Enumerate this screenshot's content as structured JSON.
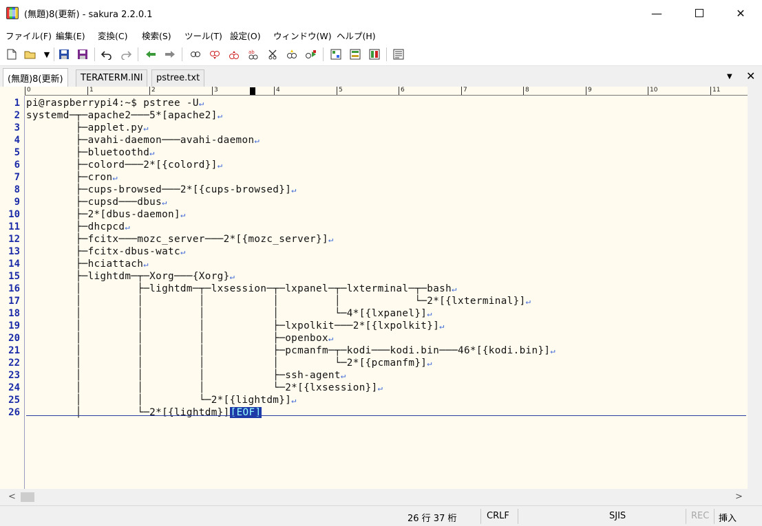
{
  "window": {
    "title": "(無題)8(更新) - sakura 2.2.0.1",
    "min_glyph": "—",
    "close_glyph": "✕"
  },
  "menu": [
    "ファイル(F)",
    "編集(E)",
    "変換(C)",
    "検索(S)",
    "ツール(T)",
    "設定(O)",
    "ウィンドウ(W)",
    "ヘルプ(H)"
  ],
  "toolbar_icons": [
    "new-file-icon",
    "open-file-icon",
    "open-dropdown-icon",
    "save-icon",
    "save-all-icon",
    "undo-icon",
    "redo-icon",
    "jump-back-icon",
    "jump-forward-icon",
    "search-icon",
    "search-next-icon",
    "search-prev-icon",
    "replace-icon",
    "grep-icon",
    "bookmark-icon",
    "mark-icon",
    "view-icon",
    "compare-icon",
    "outline-icon",
    "settings-icon"
  ],
  "tabs": [
    {
      "label": "(無題)8(更新)",
      "active": true
    },
    {
      "label": "TERATERM.INI",
      "active": false
    },
    {
      "label": "pstree.txt",
      "active": false
    }
  ],
  "tab_controls": {
    "dropdown": "▼",
    "close": "✕"
  },
  "ruler": {
    "labels": [
      "0",
      "1",
      "2",
      "3",
      "4",
      "5",
      "6",
      "7",
      "8",
      "9",
      "10",
      "11"
    ]
  },
  "editor": {
    "lines": [
      "pi@raspberrypi4:~$ pstree -U",
      "systemd─┬─apache2───5*[apache2]",
      "        ├─applet.py",
      "        ├─avahi-daemon───avahi-daemon",
      "        ├─bluetoothd",
      "        ├─colord───2*[{colord}]",
      "        ├─cron",
      "        ├─cups-browsed───2*[{cups-browsed}]",
      "        ├─cupsd───dbus",
      "        ├─2*[dbus-daemon]",
      "        ├─dhcpcd",
      "        ├─fcitx───mozc_server───2*[{mozc_server}]",
      "        ├─fcitx-dbus-watc",
      "        ├─hciattach",
      "        ├─lightdm─┬─Xorg───{Xorg}",
      "        │         ├─lightdm─┬─lxsession─┬─lxpanel─┬─lxterminal─┬─bash",
      "        │         │         │           │         │            └─2*[{lxterminal}]",
      "        │         │         │           │         └─4*[{lxpanel}]",
      "        │         │         │           ├─lxpolkit───2*[{lxpolkit}]",
      "        │         │         │           ├─openbox",
      "        │         │         │           ├─pcmanfm─┬─kodi───kodi.bin───46*[{kodi.bin}]",
      "        │         │         │           │         └─2*[{pcmanfm}]",
      "        │         │         │           ├─ssh-agent",
      "        │         │         │           └─2*[{lxsession}]",
      "        │         │         └─2*[{lightdm}]",
      "        │         └─2*[{lightdm}]"
    ],
    "eof": "[EOF]",
    "eol_mark": "↵"
  },
  "status": {
    "position": "26 行  37 桁",
    "line_ending": "CRLF",
    "encoding": "SJIS",
    "rec": "REC",
    "mode": "挿入"
  }
}
